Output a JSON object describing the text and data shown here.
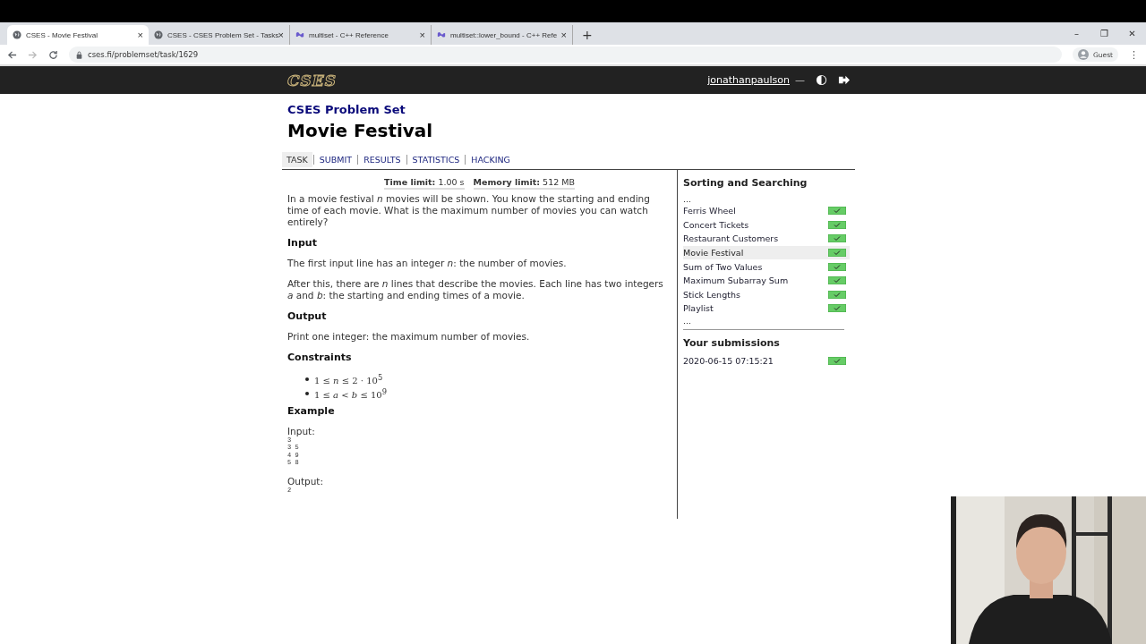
{
  "browser": {
    "tabs": [
      {
        "title": "CSES - Movie Festival",
        "selected": true,
        "close": "×"
      },
      {
        "title": "CSES - CSES Problem Set - Tasks",
        "selected": false,
        "close": "×"
      },
      {
        "title": "multiset - C++ Reference",
        "selected": false,
        "close": "×"
      },
      {
        "title": "multiset::lower_bound - C++ Refe",
        "selected": false,
        "close": "×"
      }
    ],
    "new_tab": "+",
    "window_buttons": [
      "–",
      "❐",
      "✕"
    ],
    "url": "cses.fi/problemset/task/1629",
    "profile": "Guest",
    "menu": "⋮"
  },
  "header": {
    "logo": "CSES",
    "user": "jonathanpaulson",
    "separator": "—"
  },
  "page": {
    "section": "CSES Problem Set",
    "title": "Movie Festival",
    "nav": [
      {
        "label": "TASK",
        "selected": true
      },
      {
        "label": "SUBMIT",
        "selected": false
      },
      {
        "label": "RESULTS",
        "selected": false
      },
      {
        "label": "STATISTICS",
        "selected": false
      },
      {
        "label": "HACKING",
        "selected": false
      }
    ],
    "limits": [
      {
        "label": "Time limit:",
        "value": "1.00 s"
      },
      {
        "label": "Memory limit:",
        "value": "512 MB"
      }
    ],
    "blocks": [
      {
        "kind": "p",
        "text": "In a movie festival *n* movies will be shown. You know the starting and ending time of each movie. What is the maximum number of movies you can watch entirely?"
      },
      {
        "kind": "h",
        "text": "Input"
      },
      {
        "kind": "p",
        "text": "The first input line has an integer *n*: the number of movies."
      },
      {
        "kind": "p",
        "text": "After this, there are *n* lines that describe the movies. Each line has two integers *a* and *b*: the starting and ending times of a movie."
      },
      {
        "kind": "h",
        "text": "Output"
      },
      {
        "kind": "p",
        "text": "Print one integer: the maximum number of movies."
      },
      {
        "kind": "h",
        "text": "Constraints"
      },
      {
        "kind": "li",
        "text": "1 ≤ *n* ≤ 2 · 10$^{5}$"
      },
      {
        "kind": "li",
        "text": "1 ≤ *a* < *b* ≤ 10$^{9}$"
      },
      {
        "kind": "h",
        "text": "Example"
      },
      {
        "kind": "label",
        "text": "Input:"
      },
      {
        "kind": "code",
        "lines": [
          "3",
          "3 5",
          "4 9",
          "5 8"
        ]
      },
      {
        "kind": "label",
        "text": "Output:"
      },
      {
        "kind": "code",
        "lines": [
          "2"
        ]
      }
    ]
  },
  "sidebar": {
    "title": "Sorting and Searching",
    "ellipsis_top": "...",
    "items": [
      {
        "name": "Ferris Wheel",
        "selected": false,
        "solved": true
      },
      {
        "name": "Concert Tickets",
        "selected": false,
        "solved": true
      },
      {
        "name": "Restaurant Customers",
        "selected": false,
        "solved": true
      },
      {
        "name": "Movie Festival",
        "selected": true,
        "solved": true
      },
      {
        "name": "Sum of Two Values",
        "selected": false,
        "solved": true
      },
      {
        "name": "Maximum Subarray Sum",
        "selected": false,
        "solved": true
      },
      {
        "name": "Stick Lengths",
        "selected": false,
        "solved": true
      },
      {
        "name": "Playlist",
        "selected": false,
        "solved": true
      }
    ],
    "ellipsis_bottom": "...",
    "submissions_title": "Your submissions",
    "submissions": [
      {
        "time": "2020-06-15 07:15:21",
        "solved": true
      }
    ]
  }
}
